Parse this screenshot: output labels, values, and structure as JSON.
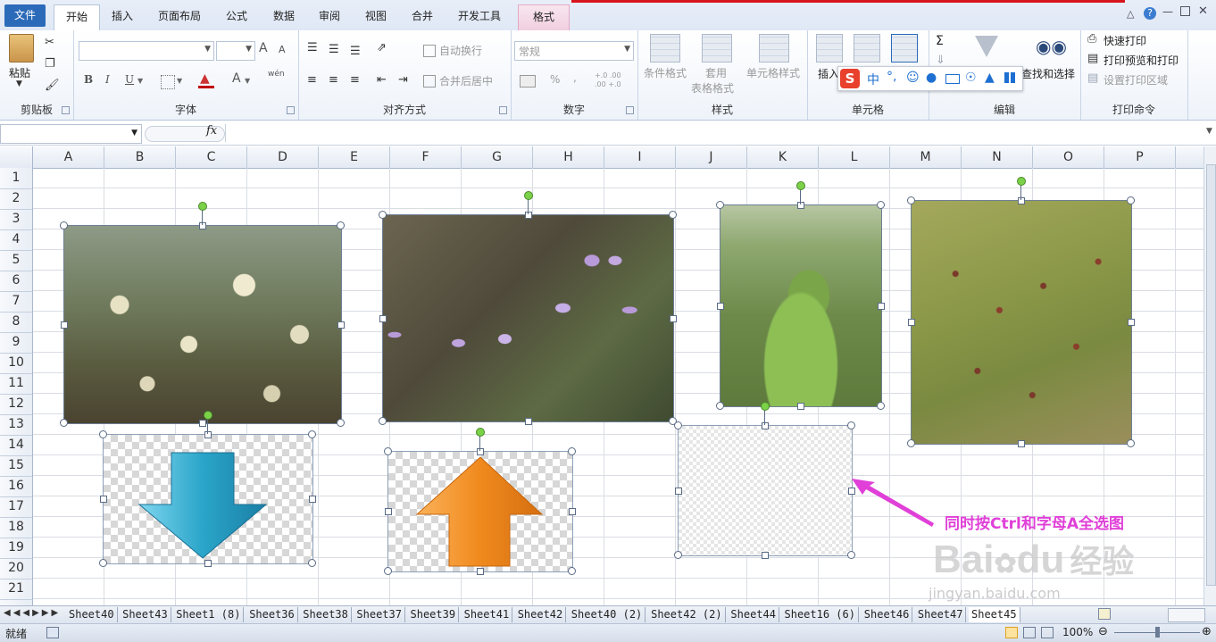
{
  "tabs": [
    {
      "label": "文件",
      "kind": "file"
    },
    {
      "label": "开始",
      "kind": "active"
    },
    {
      "label": "插入",
      "kind": "normal"
    },
    {
      "label": "页面布局",
      "kind": "normal"
    },
    {
      "label": "公式",
      "kind": "normal"
    },
    {
      "label": "数据",
      "kind": "normal"
    },
    {
      "label": "审阅",
      "kind": "normal"
    },
    {
      "label": "视图",
      "kind": "normal"
    },
    {
      "label": "合并",
      "kind": "normal"
    },
    {
      "label": "开发工具",
      "kind": "normal"
    },
    {
      "label": "格式",
      "kind": "format"
    }
  ],
  "ribbon": {
    "clipboard": {
      "group": "剪贴板",
      "paste": "粘贴"
    },
    "font": {
      "group": "字体",
      "bold": "B",
      "italic": "I",
      "underline": "U",
      "font_color_glyph": "A",
      "grow": "A",
      "shrink": "A",
      "wen": "wén"
    },
    "alignment": {
      "group": "对齐方式",
      "wrap": "自动换行",
      "merge": "合并后居中"
    },
    "number": {
      "group": "数字",
      "format": "常规",
      "percent": "%",
      "comma": ",",
      "inc": "+.0 .00",
      "dec": ".00 +.0"
    },
    "styles": {
      "group": "样式",
      "conditional": "条件格式",
      "table_line1": "套用",
      "table_line2": "表格格式",
      "cell_styles": "单元格样式"
    },
    "cells": {
      "group": "单元格",
      "insert": "插入"
    },
    "editing": {
      "group": "编辑",
      "sigma": "Σ",
      "find": "查找和选择"
    },
    "print": {
      "group": "打印命令",
      "quick": "快速打印",
      "preview": "打印预览和打印",
      "area": "设置打印区域"
    }
  },
  "ime": {
    "logo": "S",
    "lang": "中"
  },
  "formula_bar": {
    "fx": "fx"
  },
  "columns": [
    "A",
    "B",
    "C",
    "D",
    "E",
    "F",
    "G",
    "H",
    "I",
    "J",
    "K",
    "L",
    "M",
    "N",
    "O",
    "P"
  ],
  "rows": [
    "1",
    "2",
    "3",
    "4",
    "5",
    "6",
    "7",
    "8",
    "9",
    "10",
    "11",
    "12",
    "13",
    "14",
    "15",
    "16",
    "17",
    "18",
    "19",
    "20",
    "21"
  ],
  "annotation": {
    "text": "同时按Ctrl和字母A全选图",
    "color": "#e040d8"
  },
  "watermark": {
    "brand": "Bai",
    "paw": "du",
    "cn": "经验",
    "url": "jingyan.baidu.com"
  },
  "sheets": [
    "Sheet40",
    "Sheet43",
    "Sheet1 (8)",
    "Sheet36",
    "Sheet38",
    "Sheet37",
    "Sheet39",
    "Sheet41",
    "Sheet42",
    "Sheet40 (2)",
    "Sheet42 (2)",
    "Sheet44",
    "Sheet16 (6)",
    "Sheet46",
    "Sheet47",
    "Sheet45"
  ],
  "active_sheet": "Sheet45",
  "status": {
    "ready": "就绪",
    "zoom": "100%"
  },
  "colors": {
    "file_tab": "#2b6ab8",
    "arrow_down": "#2aa5c9",
    "arrow_up": "#f08a1e",
    "selection_rot": "#7bd148"
  }
}
